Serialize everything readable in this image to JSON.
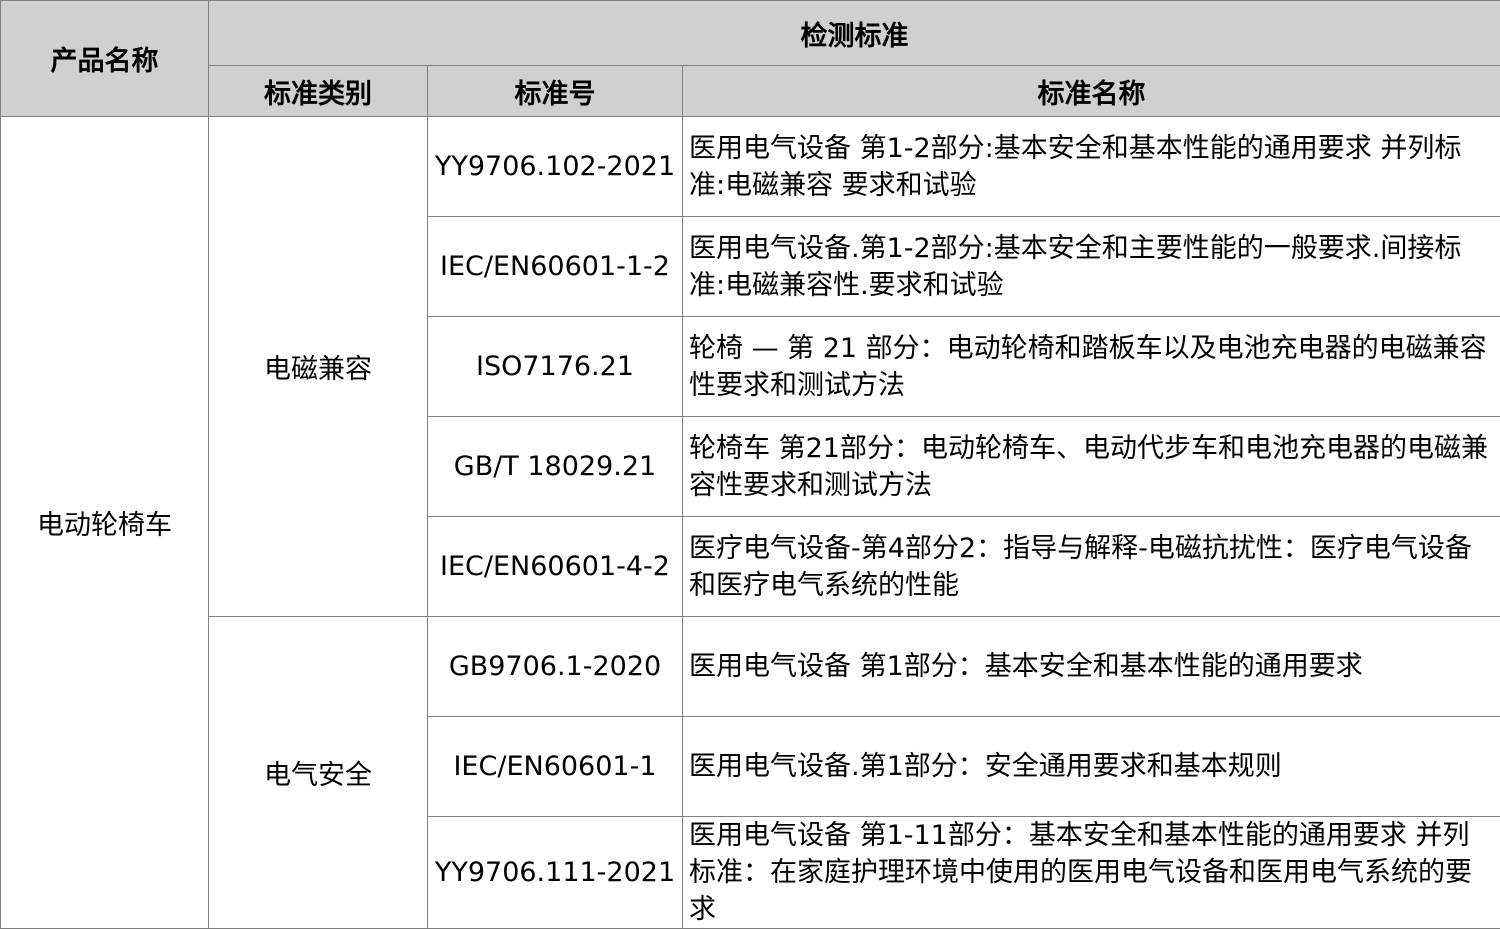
{
  "header": {
    "product_name": "产品名称",
    "test_standard": "检测标准",
    "standard_category": "标准类别",
    "standard_number": "标准号",
    "standard_name": "标准名称"
  },
  "product": "电动轮椅车",
  "categories": [
    {
      "label": "电磁兼容",
      "rows": [
        {
          "number": "YY9706.102-2021",
          "name": "医用电气设备 第1-2部分:基本安全和基本性能的通用要求 并列标准:电磁兼容 要求和试验"
        },
        {
          "number": "IEC/EN60601-1-2",
          "name": "医用电气设备.第1-2部分:基本安全和主要性能的一般要求.间接标准:电磁兼容性.要求和试验"
        },
        {
          "number": "ISO7176.21",
          "name": "轮椅 — 第 21 部分：电动轮椅和踏板车以及电池充电器的电磁兼容性要求和测试方法"
        },
        {
          "number": "GB/T 18029.21",
          "name": "轮椅车 第21部分：电动轮椅车、电动代步车和电池充电器的电磁兼容性要求和测试方法"
        },
        {
          "number": "IEC/EN60601-4-2",
          "name": "医疗电气设备-第4部分2：指导与解释-电磁抗扰性：医疗电气设备和医疗电气系统的性能"
        }
      ]
    },
    {
      "label": "电气安全",
      "rows": [
        {
          "number": "GB9706.1-2020",
          "name": "医用电气设备 第1部分：基本安全和基本性能的通用要求"
        },
        {
          "number": "IEC/EN60601-1",
          "name": "医用电气设备.第1部分：安全通用要求和基本规则"
        },
        {
          "number": "YY9706.111-2021",
          "name": "医用电气设备 第1-11部分：基本安全和基本性能的通用要求 并列标准：在家庭护理环境中使用的医用电气设备和医用电气系统的要求"
        }
      ]
    }
  ]
}
